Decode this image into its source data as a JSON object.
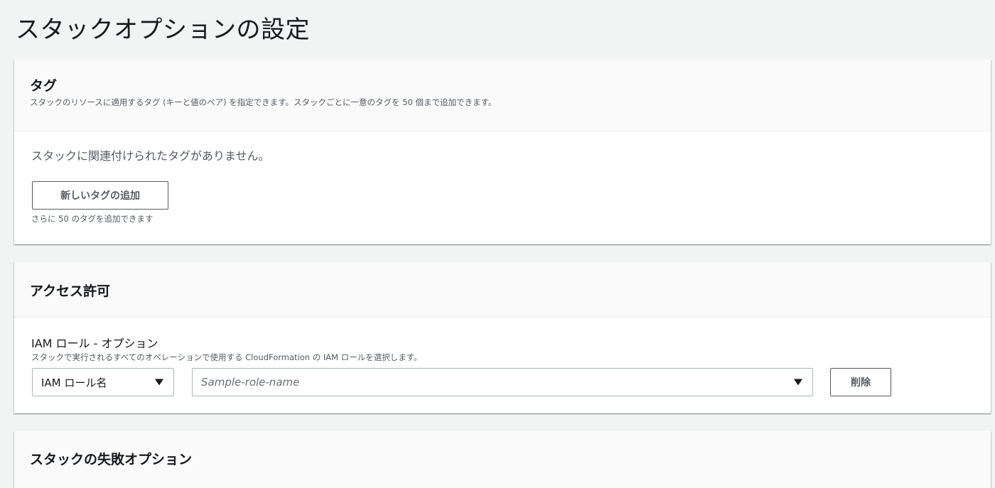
{
  "page": {
    "title": "スタックオプションの設定"
  },
  "tags": {
    "title": "タグ",
    "description": "スタックのリソースに適用するタグ (キーと値のペア) を指定できます。スタックごとに一意のタグを 50 個まで追加できます。",
    "empty_message": "スタックに関連付けられたタグがありません。",
    "add_button": "新しいタグの追加",
    "remaining_hint": "さらに 50 のタグを追加できます"
  },
  "access": {
    "title": "アクセス許可",
    "role_label": "IAM ロール - オプション",
    "role_description": "スタックで実行されるすべてのオペレーションで使用する CloudFormation の IAM ロールを選択します。",
    "role_type_selected": "IAM ロール名",
    "role_name_placeholder": "Sample-role-name",
    "remove_button": "削除",
    "icons": [
      "caret-down-icon",
      "caret-down-icon"
    ]
  },
  "failure": {
    "title": "スタックの失敗オプション"
  },
  "colors": {
    "page_bg": "#f2f3f3",
    "panel_bg": "#ffffff",
    "header_bg": "#fafafa",
    "text": "#16191f",
    "secondary_text": "#545b64",
    "input_border": "#aab7b8"
  }
}
